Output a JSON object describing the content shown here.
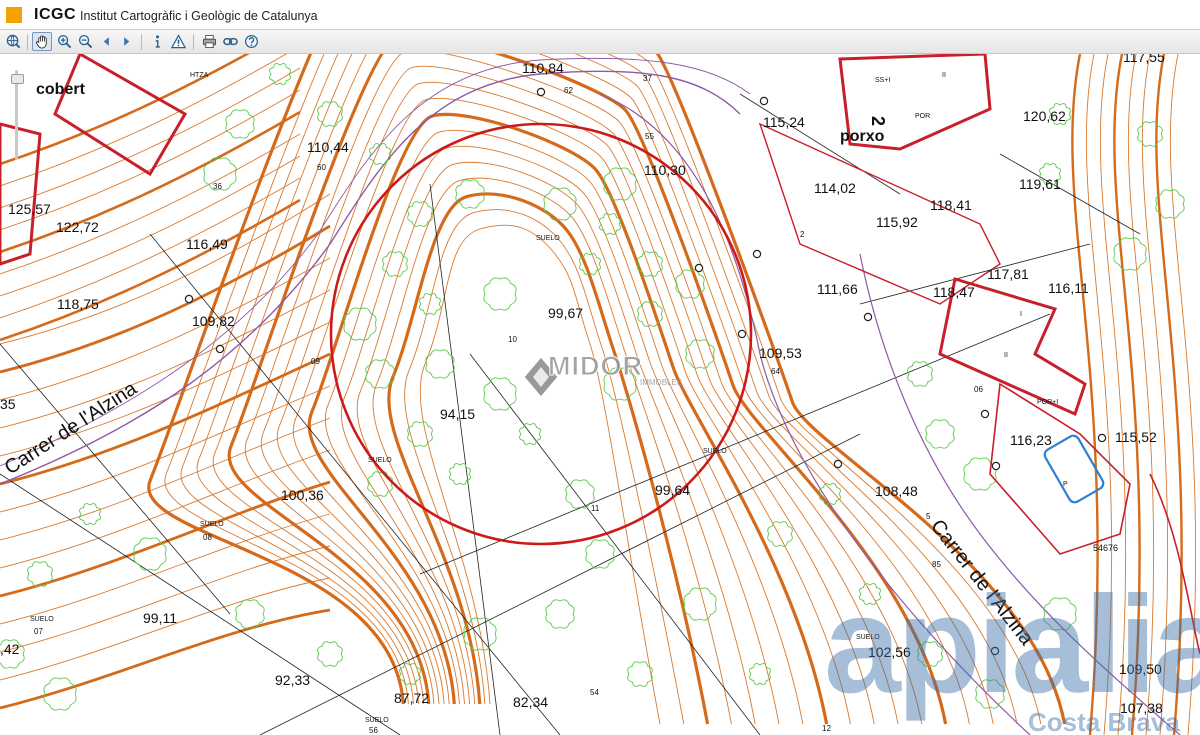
{
  "app": {
    "logo": "ICGC",
    "org_name": "Institut Cartogràfic i Geològic de Catalunya"
  },
  "toolbar": [
    {
      "id": "overview",
      "icon": "globe-icon"
    },
    {
      "id": "pan",
      "icon": "hand-icon",
      "active": true
    },
    {
      "id": "zoom-in",
      "icon": "zoom-in-icon"
    },
    {
      "id": "zoom-out",
      "icon": "zoom-out-icon"
    },
    {
      "id": "prev",
      "icon": "arrow-left-icon"
    },
    {
      "id": "next",
      "icon": "arrow-right-icon"
    },
    {
      "id": "info",
      "icon": "info-icon"
    },
    {
      "id": "warning",
      "icon": "warning-icon"
    },
    {
      "id": "print",
      "icon": "printer-icon"
    },
    {
      "id": "link",
      "icon": "link-icon"
    },
    {
      "id": "help",
      "icon": "help-icon"
    }
  ],
  "map": {
    "colors": {
      "contour": "#d9792c",
      "contour_index": "#d46a1a",
      "vegetation": "#59c84a",
      "building": "#c8202a",
      "parcel": "#c8202a",
      "road_edge": "#8c5aa8",
      "highlight_circle": "#cc1a1a",
      "line": "#222222"
    },
    "street_names": [
      "Carrer de l'Alzina",
      "Carrer de l'Alzina"
    ],
    "place_labels": [
      "cobert",
      "porxo"
    ],
    "elevations": [
      "110,84",
      "117,55",
      "115,24",
      "120,62",
      "110,44",
      "110,30",
      "125,57",
      "122,72",
      "116,49",
      "114,02",
      "119,61",
      "118,41",
      "115,92",
      "118,75",
      "109,82",
      "99,67",
      "111,66",
      "118,47",
      "117,81",
      "116,11",
      "109,53",
      "94,15",
      "116,23",
      "115,52",
      "100,36",
      "99,64",
      "108,48",
      "99,11",
      "102,56",
      "92,33",
      "87,72",
      "82,34",
      "109,50",
      "107,38",
      "35",
      ",42"
    ],
    "small_labels": [
      "37",
      "62",
      "55",
      "60",
      "36",
      "2",
      "09",
      "10",
      "11",
      "06",
      "64",
      "85",
      "5",
      "08",
      "07",
      "54",
      "56",
      "12",
      "SUELO",
      "SUELO",
      "SUELO",
      "SUELO",
      "SUELO",
      "SUELO",
      "SUELO",
      "HTZA",
      "POR",
      "SS+I",
      "II",
      "POR+I",
      "I",
      "II",
      "P",
      "54676",
      "2"
    ],
    "watermarks": {
      "midor_main": "MIDOR",
      "midor_sub": "IMMOBLES",
      "apialia": "apialia",
      "apialia_sub": "Costa Brava"
    }
  }
}
